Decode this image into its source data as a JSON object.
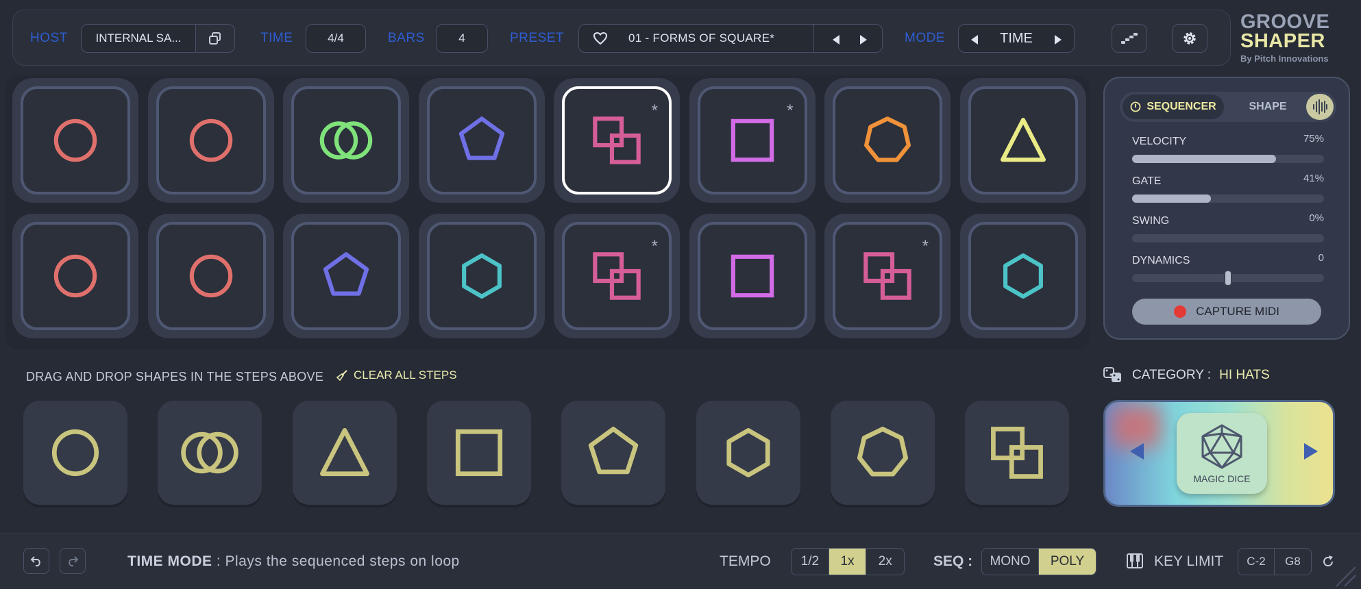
{
  "header": {
    "host_label": "HOST",
    "host_value": "INTERNAL SA...",
    "time_label": "TIME",
    "time_value": "4/4",
    "bars_label": "BARS",
    "bars_value": "4",
    "preset_label": "PRESET",
    "preset_value": "01 - FORMS OF SQUARE*",
    "mode_label": "MODE",
    "mode_value": "TIME"
  },
  "logo": {
    "line1": "GROOVE",
    "line2": "SHAPER",
    "line3": "By Pitch Innovations"
  },
  "steps": [
    {
      "shape": "circle",
      "color": "#e0706c",
      "star": false,
      "selected": false
    },
    {
      "shape": "circle",
      "color": "#e0706c",
      "star": false,
      "selected": false
    },
    {
      "shape": "double-circle",
      "color": "#7fe27a",
      "star": false,
      "selected": false
    },
    {
      "shape": "pentagon",
      "color": "#7070e6",
      "star": false,
      "selected": false
    },
    {
      "shape": "double-square",
      "color": "#d65e98",
      "star": true,
      "selected": true
    },
    {
      "shape": "square",
      "color": "#d26be6",
      "star": true,
      "selected": false
    },
    {
      "shape": "heptagon",
      "color": "#f0923a",
      "star": false,
      "selected": false
    },
    {
      "shape": "triangle",
      "color": "#eaea86",
      "star": false,
      "selected": false
    },
    {
      "shape": "circle",
      "color": "#e0706c",
      "star": false,
      "selected": false
    },
    {
      "shape": "circle",
      "color": "#e0706c",
      "star": false,
      "selected": false
    },
    {
      "shape": "pentagon",
      "color": "#7070e6",
      "star": false,
      "selected": false
    },
    {
      "shape": "hexagon",
      "color": "#4cc3c7",
      "star": false,
      "selected": false
    },
    {
      "shape": "double-square",
      "color": "#d65e98",
      "star": true,
      "selected": false
    },
    {
      "shape": "square",
      "color": "#d26be6",
      "star": false,
      "selected": false
    },
    {
      "shape": "double-square",
      "color": "#d65e98",
      "star": true,
      "selected": false
    },
    {
      "shape": "hexagon",
      "color": "#4cc3c7",
      "star": false,
      "selected": false
    }
  ],
  "star_glyph": "*",
  "side": {
    "tab_sequencer": "SEQUENCER",
    "tab_shape": "SHAPE",
    "params": [
      {
        "name": "VELOCITY",
        "value": "75%",
        "level": 0.75,
        "type": "fill"
      },
      {
        "name": "GATE",
        "value": "41%",
        "level": 0.41,
        "type": "fill"
      },
      {
        "name": "SWING",
        "value": "0%",
        "level": 0.0,
        "type": "fill"
      },
      {
        "name": "DYNAMICS",
        "value": "0",
        "level": 0.5,
        "type": "knob"
      }
    ],
    "capture_label": "CAPTURE MIDI"
  },
  "palette": {
    "hint": "DRAG AND DROP SHAPES IN THE STEPS ABOVE",
    "clear_label": "CLEAR ALL STEPS",
    "shapes": [
      "circle",
      "double-circle",
      "triangle",
      "square",
      "pentagon",
      "hexagon",
      "heptagon",
      "double-square"
    ],
    "color": "#c9c47e"
  },
  "category": {
    "label": "CATEGORY :",
    "value": "HI HATS"
  },
  "dice": {
    "label": "MAGIC DICE"
  },
  "footer": {
    "mode_title": "TIME MODE",
    "mode_desc": " : Plays the sequenced steps on loop",
    "tempo_label": "TEMPO",
    "tempo_options": [
      "1/2",
      "1x",
      "2x"
    ],
    "tempo_selected": "1x",
    "seq_label": "SEQ :",
    "seq_options": [
      "MONO",
      "POLY"
    ],
    "seq_selected": "POLY",
    "key_limit_label": "KEY LIMIT",
    "key_low": "C-2",
    "key_high": "G8"
  }
}
